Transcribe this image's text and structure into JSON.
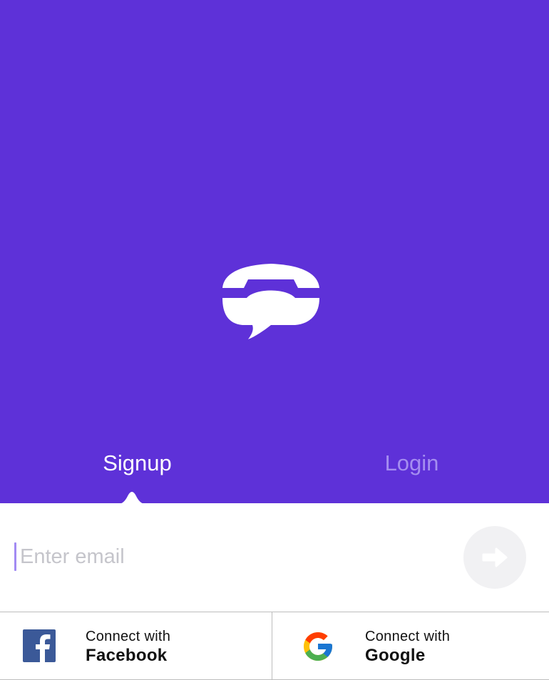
{
  "app": {
    "name": "TextNow"
  },
  "brand": {
    "background": "#5e31d8",
    "tab_inactive": "#a58ef0",
    "caret": "#a28bf3"
  },
  "tabs": {
    "signup_label": "Signup",
    "login_label": "Login",
    "active": "Signup"
  },
  "email": {
    "placeholder": "Enter email",
    "value": ""
  },
  "submit": {
    "icon": "arrow-right-icon"
  },
  "social": {
    "facebook": {
      "line1": "Connect with",
      "line2": "Facebook",
      "icon": "facebook-icon"
    },
    "google": {
      "line1": "Connect with",
      "line2": "Google",
      "icon": "google-icon"
    }
  }
}
